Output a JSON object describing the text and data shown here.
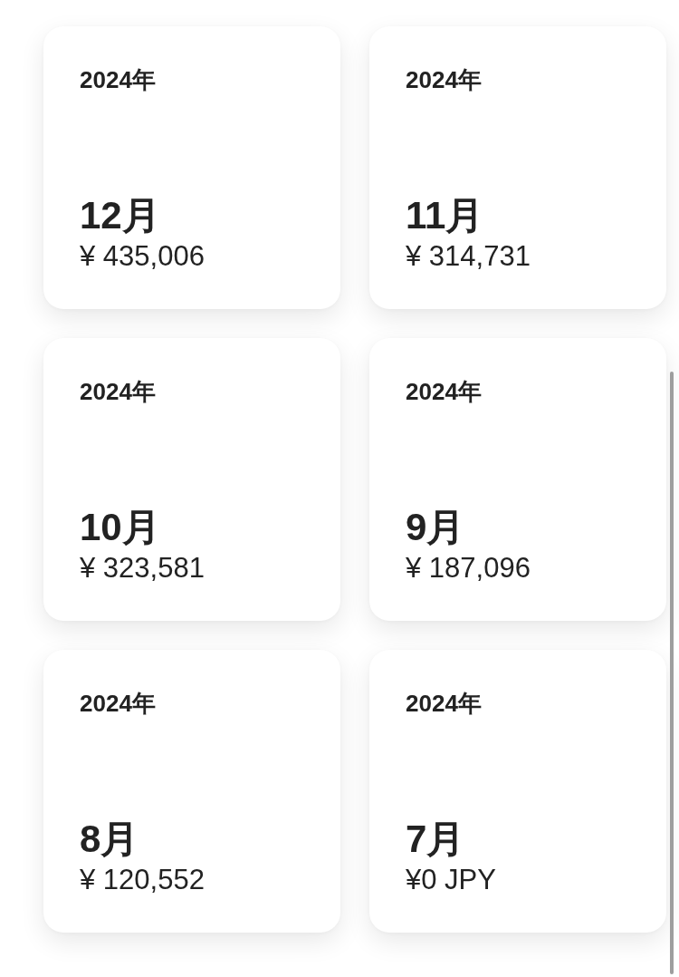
{
  "cards": [
    {
      "year": "2024年",
      "month": "12月",
      "amount": "¥ 435,006"
    },
    {
      "year": "2024年",
      "month": "11月",
      "amount": "¥ 314,731"
    },
    {
      "year": "2024年",
      "month": "10月",
      "amount": "¥ 323,581"
    },
    {
      "year": "2024年",
      "month": "9月",
      "amount": "¥ 187,096"
    },
    {
      "year": "2024年",
      "month": "8月",
      "amount": "¥ 120,552"
    },
    {
      "year": "2024年",
      "month": "7月",
      "amount": "¥0 JPY"
    }
  ]
}
